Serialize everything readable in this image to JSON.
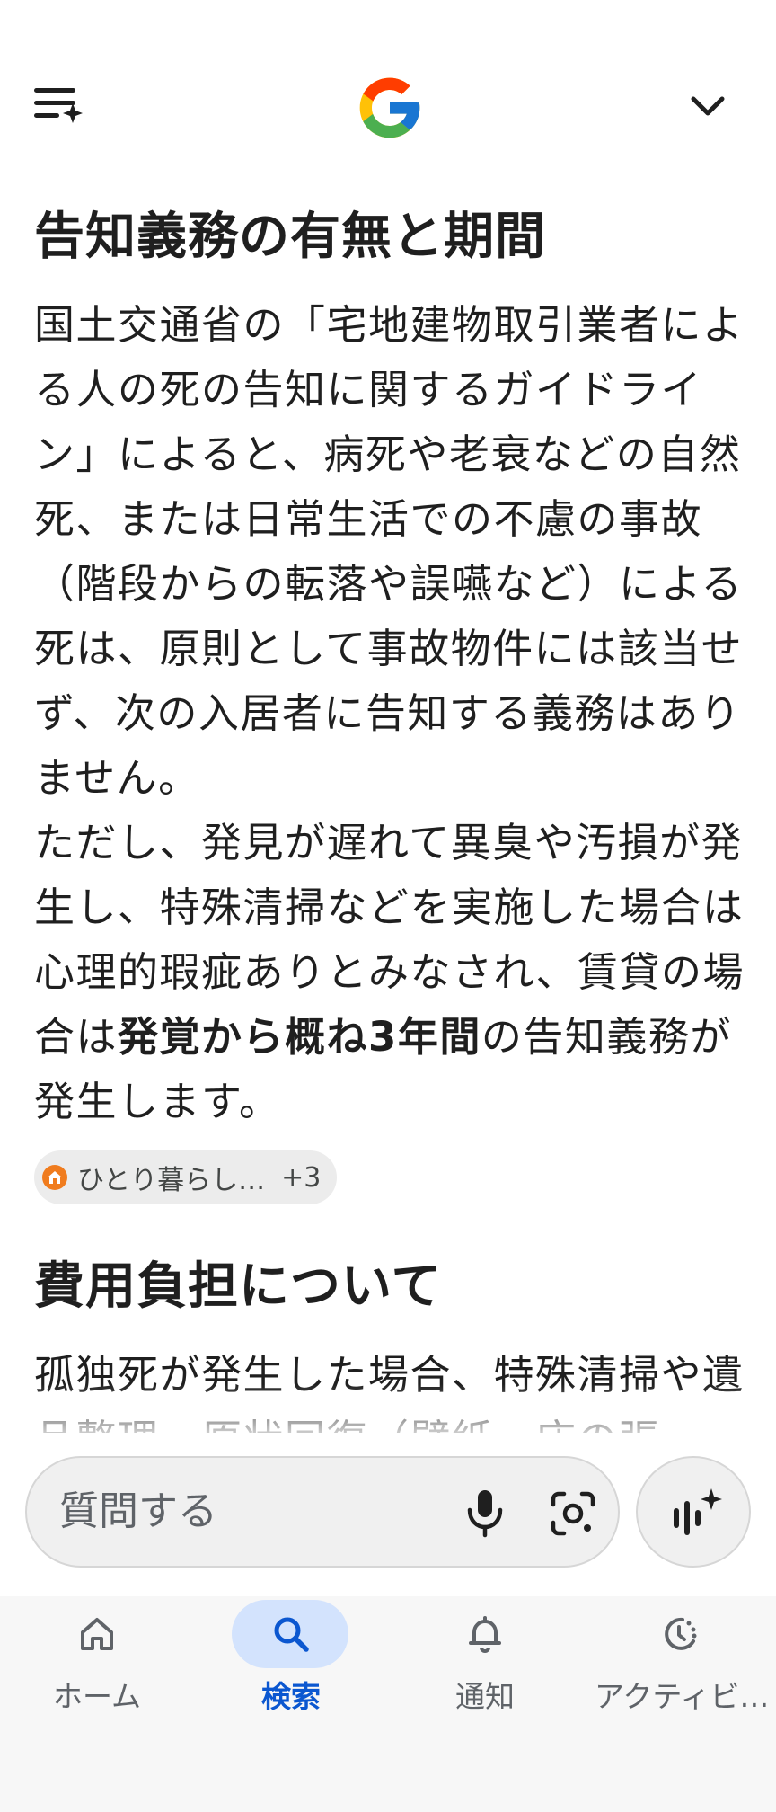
{
  "header": {
    "menu_icon": "sort-sparkle-icon",
    "logo": "google-g-logo",
    "expand_icon": "chevron-down-icon"
  },
  "sections": [
    {
      "heading": "告知義務の有無と期間",
      "paragraph1": "国土交通省の「宅地建物取引業者による人の死の告知に関するガイドライン」によると、病死や老衰などの自然死、または日常生活での不慮の事故（階段からの転落や誤嚥など）による死は、原則として事故物件には該当せず、次の入居者に告知する義務はありません。",
      "paragraph2_pre": "ただし、発見が遅れて異臭や汚損が発生し、特殊清掃などを実施した場合は心理的瑕疵ありとみなされ、賃貸の場合は",
      "paragraph2_bold": "発覚から概ね3年間",
      "paragraph2_post": "の告知義務が発生します。",
      "source_chip": {
        "label": "ひとり暮らし…",
        "count": "+3",
        "icon": "house-favicon-icon"
      }
    },
    {
      "heading": "費用負担について",
      "paragraph1": "孤独死が発生した場合、特殊清掃や遺品整理、原状回復（壁紙・床の張"
    }
  ],
  "ask_bar": {
    "placeholder": "質問する",
    "mic_icon": "microphone-icon",
    "lens_icon": "lens-camera-icon",
    "ai_icon": "ai-mode-sparkle-icon"
  },
  "bottom_nav": {
    "items": [
      {
        "label": "ホーム",
        "icon": "home-icon",
        "active": false
      },
      {
        "label": "検索",
        "icon": "search-icon",
        "active": true
      },
      {
        "label": "通知",
        "icon": "bell-icon",
        "active": false
      },
      {
        "label": "アクティビ…",
        "icon": "activity-icon",
        "active": false
      }
    ]
  },
  "colors": {
    "accent": "#0b57d0",
    "active_pill": "#d3e3fd",
    "text": "#1f1f1f",
    "muted": "#5f6368",
    "chip_bg": "#ececec",
    "favicon_orange": "#f07c1e"
  }
}
